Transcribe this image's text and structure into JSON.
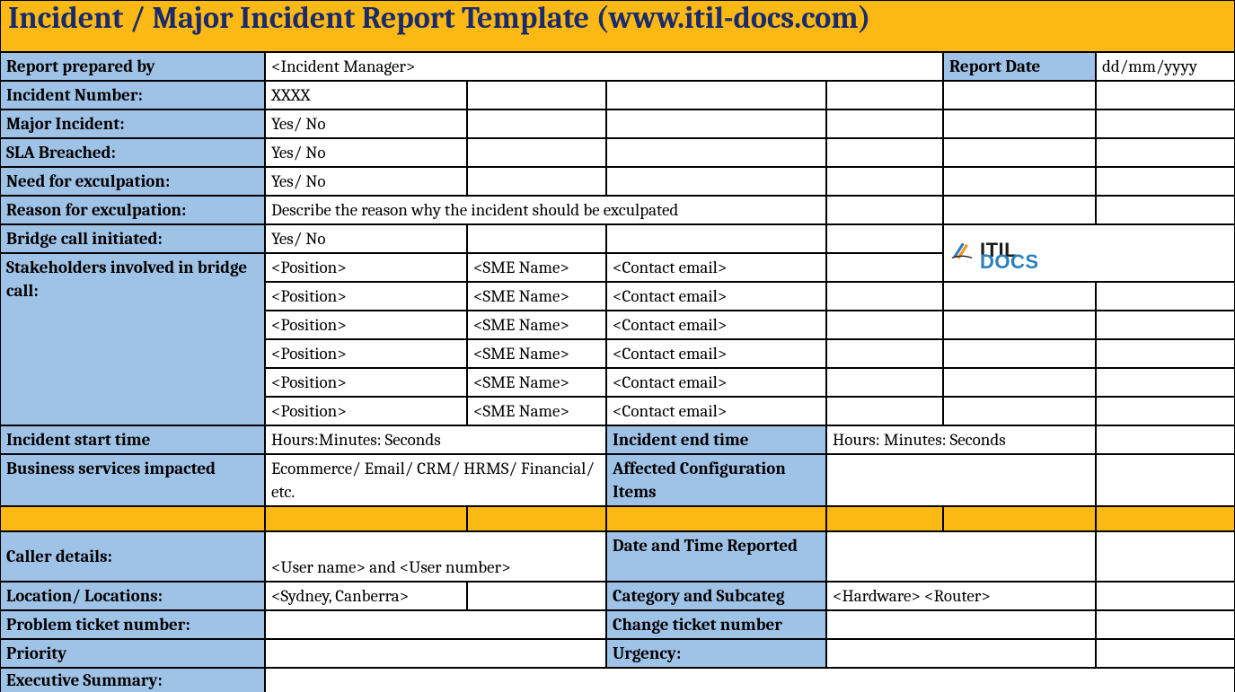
{
  "title": "Incident / Major Incident Report Template   (www.itil-docs.com)",
  "labels": {
    "prepared_by": "Report prepared by",
    "report_date": "Report Date",
    "incident_number": "Incident Number:",
    "major_incident": "Major Incident:",
    "sla_breached": "SLA Breached:",
    "need_exculp": "Need for exculpation:",
    "reason_exculp": "Reason for exculpation:",
    "bridge_call": "Bridge call initiated:",
    "stakeholders": "Stakeholders involved in bridge call:",
    "start_time": "Incident start time",
    "end_time": "Incident end time",
    "services": "Business services impacted",
    "affected_ci": "Affected Configuration Items",
    "caller": "Caller details:",
    "date_reported": "Date and Time Reported",
    "locations": "Location/ Locations:",
    "category": "Category and Subcateg",
    "problem_ticket": "Problem ticket number:",
    "change_ticket": "Change ticket number",
    "priority": "Priority",
    "urgency": "Urgency:",
    "exec_summary": "Executive Summary:"
  },
  "values": {
    "prepared_by": "<Incident Manager>",
    "report_date": "dd/mm/yyyy",
    "incident_number": "XXXX",
    "major_incident": "Yes/ No",
    "sla_breached": "Yes/ No",
    "need_exculp": "Yes/ No",
    "reason_exculp": "Describe the reason why the incident should be exculpated",
    "bridge_call": "Yes/ No",
    "stakeholders": [
      {
        "position": "<Position>",
        "sme": "<SME Name>",
        "email": "<Contact email>"
      },
      {
        "position": "<Position>",
        "sme": "<SME Name>",
        "email": "<Contact email>"
      },
      {
        "position": "<Position>",
        "sme": "<SME Name>",
        "email": "<Contact email>"
      },
      {
        "position": "<Position>",
        "sme": "<SME Name>",
        "email": "<Contact email>"
      },
      {
        "position": "<Position>",
        "sme": "<SME Name>",
        "email": "<Contact email>"
      },
      {
        "position": "<Position>",
        "sme": "<SME Name>",
        "email": "<Contact email>"
      }
    ],
    "start_time": "Hours:Minutes: Seconds",
    "end_time": "Hours: Minutes: Seconds",
    "services": "Ecommerce/ Email/ CRM/ HRMS/ Financial/ etc.",
    "caller": "<User name> and <User number>",
    "locations": "<Sydney, Canberra>",
    "category": "<Hardware> <Router>"
  },
  "logo": {
    "brand1": "ITIL",
    "brand2": "DOCS"
  }
}
